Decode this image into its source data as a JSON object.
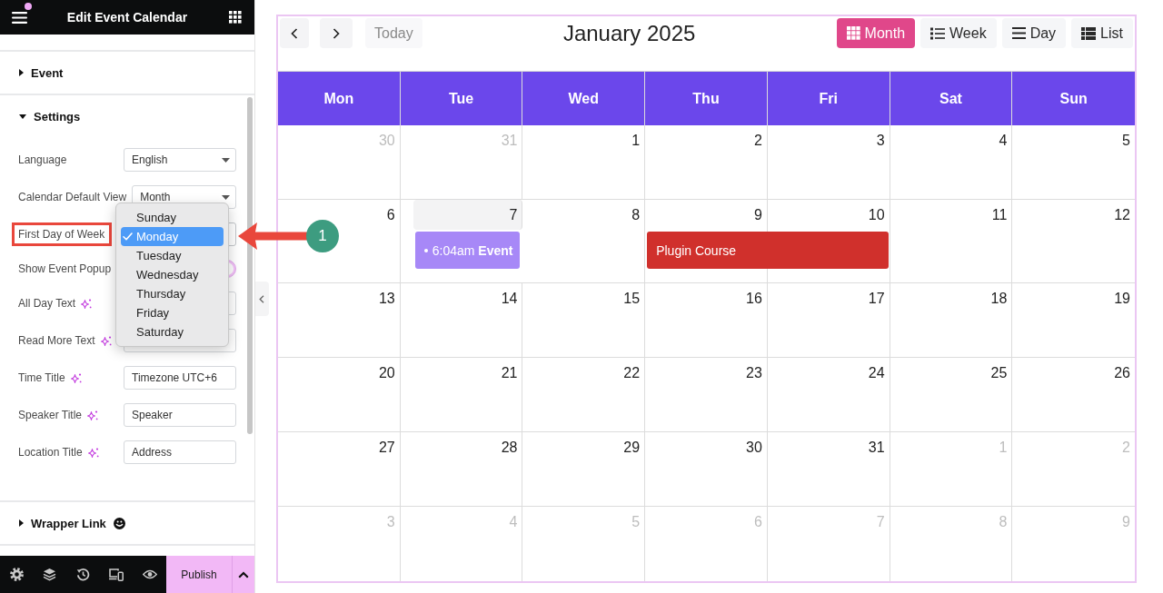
{
  "editor": {
    "title": "Edit Event Calendar",
    "menu_notification": true,
    "sections": [
      {
        "title": "Event",
        "expanded": false,
        "pro_icon": false
      },
      {
        "title": "Settings",
        "expanded": true,
        "pro_icon": false,
        "controls": [
          {
            "kind": "select",
            "label": "Language",
            "value": "English",
            "highlighted": false,
            "ai_icon": false,
            "open": false
          },
          {
            "kind": "select",
            "label": "Calendar Default View",
            "value": "Month",
            "highlighted": false,
            "ai_icon": false,
            "open": false
          },
          {
            "kind": "select",
            "label": "First Day of Week",
            "highlighted": true,
            "ai_icon": false,
            "open": true,
            "options": [
              {
                "label": "Sunday",
                "selected": false
              },
              {
                "label": "Monday",
                "selected": true
              },
              {
                "label": "Tuesday",
                "selected": false
              },
              {
                "label": "Wednesday",
                "selected": false
              },
              {
                "label": "Thursday",
                "selected": false
              },
              {
                "label": "Friday",
                "selected": false
              },
              {
                "label": "Saturday",
                "selected": false
              }
            ]
          },
          {
            "kind": "toggle",
            "label": "Show Event Popup",
            "highlighted": false,
            "ai_icon": false,
            "on": true
          },
          {
            "kind": "text",
            "label": "All Day Text",
            "highlighted": false,
            "ai_icon": true
          },
          {
            "kind": "text",
            "label": "Read More Text",
            "highlighted": false,
            "ai_icon": true
          },
          {
            "kind": "text",
            "label": "Time Title",
            "value": "Timezone UTC+6",
            "highlighted": false,
            "ai_icon": true
          },
          {
            "kind": "text",
            "label": "Speaker Title",
            "value": "Speaker",
            "highlighted": false,
            "ai_icon": true
          },
          {
            "kind": "text",
            "label": "Location Title",
            "value": "Address",
            "highlighted": false,
            "ai_icon": true
          }
        ]
      },
      {
        "title": "Wrapper Link",
        "expanded": false,
        "pro_icon": true
      }
    ],
    "footer": {
      "publish": {
        "label": "Publish"
      }
    }
  },
  "callout": {
    "number": "1"
  },
  "calendar": {
    "title": "January 2025",
    "today_button": {
      "label": "Today",
      "disabled": true
    },
    "views": [
      {
        "kind": "month",
        "label": "Month",
        "selected": true
      },
      {
        "kind": "week",
        "label": "Week",
        "selected": false
      },
      {
        "kind": "day",
        "label": "Day",
        "selected": false
      },
      {
        "kind": "list",
        "label": "List",
        "selected": false
      }
    ],
    "weekdays": [
      "Mon",
      "Tue",
      "Wed",
      "Thu",
      "Fri",
      "Sat",
      "Sun"
    ],
    "weeks": [
      {
        "days": [
          {
            "label": "30",
            "outside_month": true,
            "today": false
          },
          {
            "label": "31",
            "outside_month": true,
            "today": false
          },
          {
            "label": "1",
            "outside_month": false,
            "today": false
          },
          {
            "label": "2",
            "outside_month": false,
            "today": false
          },
          {
            "label": "3",
            "outside_month": false,
            "today": false
          },
          {
            "label": "4",
            "outside_month": false,
            "today": false
          },
          {
            "label": "5",
            "outside_month": false,
            "today": false
          }
        ]
      },
      {
        "days": [
          {
            "label": "6",
            "outside_month": false,
            "today": false
          },
          {
            "label": "7",
            "outside_month": false,
            "today": true,
            "events": [
              {
                "kind": "timed",
                "time": "6:04am",
                "title": "Event",
                "color": "#a788f7",
                "continues_next_day": false
              }
            ]
          },
          {
            "label": "8",
            "outside_month": false,
            "today": false
          },
          {
            "label": "9",
            "outside_month": false,
            "today": false,
            "events": [
              {
                "kind": "all_day",
                "title": "Plugin Course",
                "color": "#d0302c",
                "continues_next_day": true
              }
            ]
          },
          {
            "label": "10",
            "outside_month": false,
            "today": false
          },
          {
            "label": "11",
            "outside_month": false,
            "today": false
          },
          {
            "label": "12",
            "outside_month": false,
            "today": false
          }
        ]
      },
      {
        "days": [
          {
            "label": "13",
            "outside_month": false,
            "today": false
          },
          {
            "label": "14",
            "outside_month": false,
            "today": false
          },
          {
            "label": "15",
            "outside_month": false,
            "today": false
          },
          {
            "label": "16",
            "outside_month": false,
            "today": false
          },
          {
            "label": "17",
            "outside_month": false,
            "today": false
          },
          {
            "label": "18",
            "outside_month": false,
            "today": false
          },
          {
            "label": "19",
            "outside_month": false,
            "today": false
          }
        ]
      },
      {
        "days": [
          {
            "label": "20",
            "outside_month": false,
            "today": false
          },
          {
            "label": "21",
            "outside_month": false,
            "today": false
          },
          {
            "label": "22",
            "outside_month": false,
            "today": false
          },
          {
            "label": "23",
            "outside_month": false,
            "today": false
          },
          {
            "label": "24",
            "outside_month": false,
            "today": false
          },
          {
            "label": "25",
            "outside_month": false,
            "today": false
          },
          {
            "label": "26",
            "outside_month": false,
            "today": false
          }
        ]
      },
      {
        "days": [
          {
            "label": "27",
            "outside_month": false,
            "today": false
          },
          {
            "label": "28",
            "outside_month": false,
            "today": false
          },
          {
            "label": "29",
            "outside_month": false,
            "today": false
          },
          {
            "label": "30",
            "outside_month": false,
            "today": false
          },
          {
            "label": "31",
            "outside_month": false,
            "today": false
          },
          {
            "label": "1",
            "outside_month": true,
            "today": false
          },
          {
            "label": "2",
            "outside_month": true,
            "today": false
          }
        ]
      },
      {
        "days": [
          {
            "label": "3",
            "outside_month": true,
            "today": false
          },
          {
            "label": "4",
            "outside_month": true,
            "today": false
          },
          {
            "label": "5",
            "outside_month": true,
            "today": false
          },
          {
            "label": "6",
            "outside_month": true,
            "today": false
          },
          {
            "label": "7",
            "outside_month": true,
            "today": false
          },
          {
            "label": "8",
            "outside_month": true,
            "today": false
          },
          {
            "label": "9",
            "outside_month": true,
            "today": false
          }
        ]
      }
    ]
  }
}
